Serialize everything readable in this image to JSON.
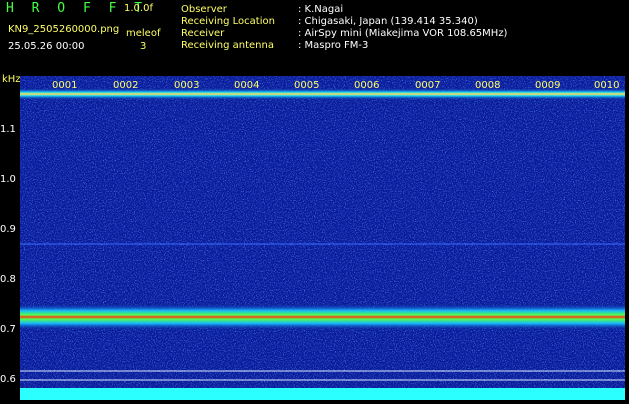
{
  "header": {
    "app_title": "H R O F F T",
    "version": "1.0.0f",
    "filename": "KN9_2505260000.png",
    "datetime": "25.05.26 00:00",
    "mode_label": "meleof",
    "mode_value": "3",
    "info": [
      {
        "label": "Observer",
        "value": ": K.Nagai"
      },
      {
        "label": "Receiving Location",
        "value": ": Chigasaki, Japan (139.414 35.340)"
      },
      {
        "label": "Receiver",
        "value": ": AirSpy mini (Miakejima VOR 108.65MHz)"
      },
      {
        "label": "Receiving antenna",
        "value": ": Maspro FM-3"
      }
    ]
  },
  "axis": {
    "unit": "kHz",
    "ticks": [
      "1.1",
      "1.0",
      "0.9",
      "0.8",
      "0.7",
      "0.6"
    ]
  },
  "time_markers": [
    "0001",
    "0002",
    "0003",
    "0004",
    "0005",
    "0006",
    "0007",
    "0008",
    "0009",
    "0010"
  ],
  "colors": {
    "background": "#000000",
    "noise_base": "#0a1a9a",
    "label": "#ffff66"
  }
}
